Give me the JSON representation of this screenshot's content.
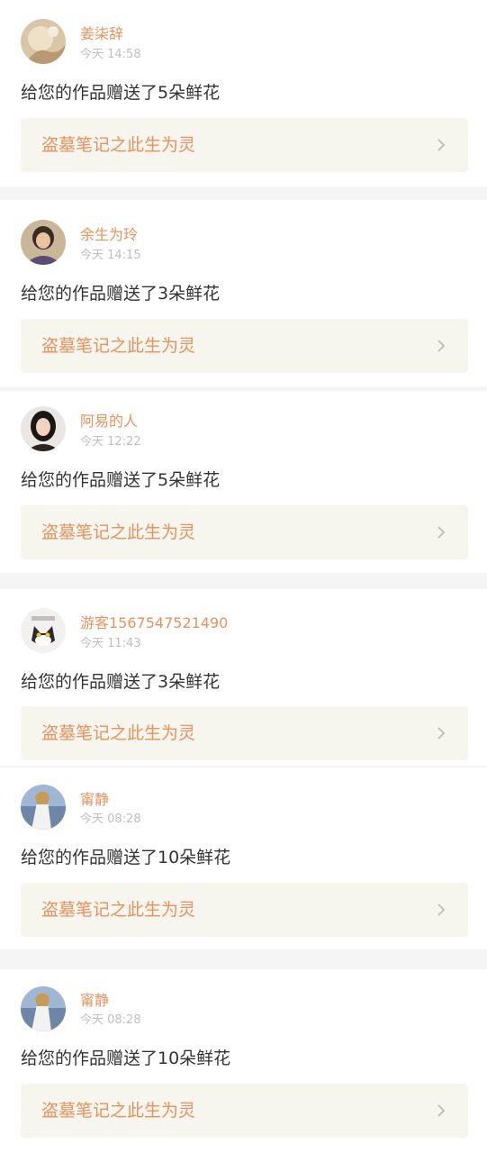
{
  "colors": {
    "name": "#e8925d",
    "time": "#bfbfbf",
    "message": "#333333",
    "work_bg": "#f6f5ee",
    "work_text": "#e8925d",
    "chevron": "#bbbbbb"
  },
  "feed": {
    "items": [
      {
        "name": "姜柒辞",
        "time": "今天 14:58",
        "message": "给您的作品赠送了5朵鲜花",
        "work": "盗墓笔记之此生为灵",
        "avatar": "avatar-photo"
      },
      {
        "name": "余生为玲",
        "time": "今天 14:15",
        "message": "给您的作品赠送了3朵鲜花",
        "work": "盗墓笔记之此生为灵",
        "avatar": "avatar-photo"
      },
      {
        "name": "阿易的人",
        "time": "今天 12:22",
        "message": "给您的作品赠送了5朵鲜花",
        "work": "盗墓笔记之此生为灵",
        "avatar": "avatar-photo"
      },
      {
        "name": "游客1567547521490",
        "time": "今天 11:43",
        "message": "给您的作品赠送了3朵鲜花",
        "work": "盗墓笔记之此生为灵",
        "avatar": "avatar-cat-illustration"
      },
      {
        "name": "甯静",
        "time": "今天 08:28",
        "message": "给您的作品赠送了10朵鲜花",
        "work": "盗墓笔记之此生为灵",
        "avatar": "avatar-photo"
      },
      {
        "name": "甯静",
        "time": "今天 08:28",
        "message": "给您的作品赠送了10朵鲜花",
        "work": "盗墓笔记之此生为灵",
        "avatar": "avatar-photo"
      }
    ]
  }
}
